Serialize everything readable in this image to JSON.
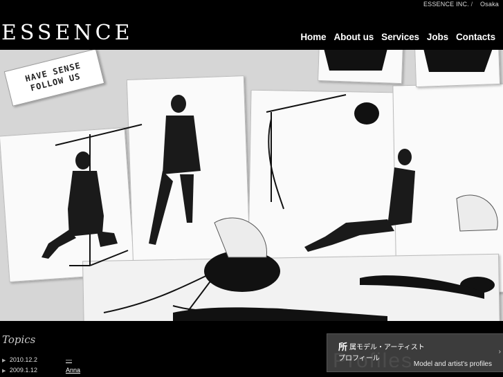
{
  "header": {
    "company": "ESSENCE INC.",
    "separator": "/",
    "city": "Osaka",
    "logo": "ESSENCE"
  },
  "nav": [
    {
      "label": "Home"
    },
    {
      "label": "About us"
    },
    {
      "label": "Services"
    },
    {
      "label": "Jobs"
    },
    {
      "label": "Contacts"
    }
  ],
  "hero": {
    "sign_line1": "HAVE SENSE",
    "sign_line2": "FOLLOW US"
  },
  "topics": {
    "title": "Topics",
    "items": [
      {
        "date": "2010.12.2",
        "link": "—"
      },
      {
        "date": "2009.1.12",
        "link": "Anna"
      }
    ]
  },
  "profile": {
    "kanji": "所",
    "line1": "属モデル・アーティスト",
    "line2": "プロフィール",
    "ghost": "Profiles",
    "english": "Model and artist's profiles",
    "chevron": "›"
  }
}
